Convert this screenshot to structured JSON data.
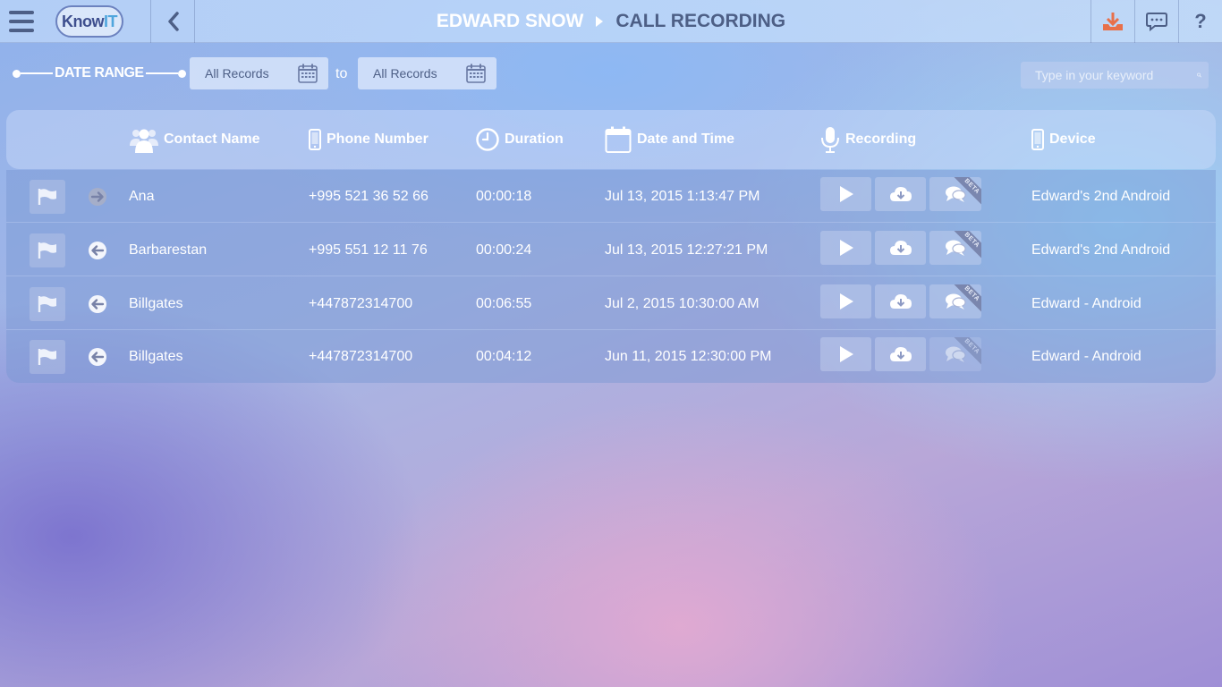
{
  "app": {
    "logo_know": "Know",
    "logo_it": "IT"
  },
  "breadcrumb": {
    "user": "EDWARD SNOW",
    "page": "CALL RECORDING"
  },
  "filters": {
    "date_range_label": "DATE RANGE",
    "from_value": "All Records",
    "to_label": "to",
    "to_value": "All Records",
    "search_placeholder": "Type in your keyword"
  },
  "table": {
    "columns": {
      "contact": "Contact Name",
      "phone": "Phone Number",
      "duration": "Duration",
      "datetime": "Date and Time",
      "recording": "Recording",
      "device": "Device"
    },
    "beta_label": "BETA",
    "rows": [
      {
        "direction": "outgoing",
        "contact": "Ana",
        "phone": "+995 521 36 52 66",
        "duration": "00:00:18",
        "datetime": "Jul 13, 2015 1:13:47 PM",
        "device": "Edward's 2nd Android"
      },
      {
        "direction": "incoming",
        "contact": "Barbarestan",
        "phone": "+995 551 12 11 76",
        "duration": "00:00:24",
        "datetime": "Jul 13, 2015 12:27:21 PM",
        "device": "Edward's 2nd Android"
      },
      {
        "direction": "incoming",
        "contact": "Billgates",
        "phone": "+447872314700",
        "duration": "00:06:55",
        "datetime": "Jul 2, 2015 10:30:00 AM",
        "device": "Edward - Android"
      },
      {
        "direction": "incoming",
        "contact": "Billgates",
        "phone": "+447872314700",
        "duration": "00:04:12",
        "datetime": "Jun 11, 2015 12:30:00 PM",
        "device": "Edward - Android"
      }
    ]
  },
  "colors": {
    "accent_download": "#e8704a",
    "dark_text": "#4d5f86"
  }
}
